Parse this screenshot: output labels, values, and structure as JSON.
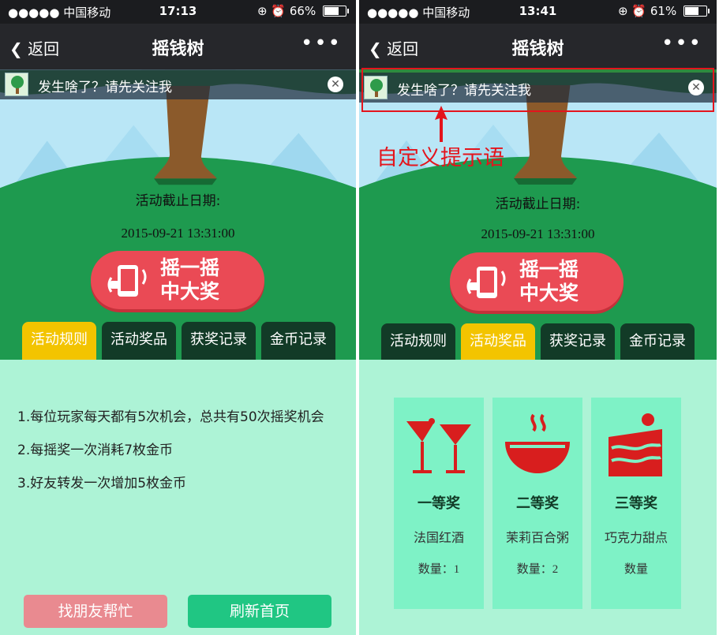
{
  "screens": [
    {
      "status": {
        "carrier": "●●●●● 中国移动",
        "time": "17:13",
        "battery": "66%",
        "battery_level": 0.66
      },
      "nav": {
        "back": "返回",
        "title": "摇钱树",
        "more": "•••"
      },
      "notice": {
        "text": "发生啥了？请先关注我",
        "close": "✕"
      },
      "deadline_label": "活动截止日期:",
      "deadline_value": "2015-09-21 13:31:00",
      "shake_button": {
        "line1": "摇一摇",
        "line2": "中大奖"
      },
      "tabs": [
        "活动规则",
        "活动奖品",
        "获奖记录",
        "金币记录"
      ],
      "active_tab": "活动规则",
      "rules": [
        "1.每位玩家每天都有5次机会，总共有50次摇奖机会",
        "2.每摇奖一次消耗7枚金币",
        "3.好友转发一次增加5枚金币"
      ],
      "buttons": {
        "help": "找朋友帮忙",
        "refresh": "刷新首页"
      }
    },
    {
      "status": {
        "carrier": "●●●●● 中国移动",
        "time": "13:41",
        "battery": "61%",
        "battery_level": 0.61
      },
      "nav": {
        "back": "返回",
        "title": "摇钱树",
        "more": "•••"
      },
      "notice": {
        "text": "发生啥了？请先关注我",
        "close": "✕"
      },
      "annotation": "自定义提示语",
      "deadline_label": "活动截止日期:",
      "deadline_value": "2015-09-21 13:31:00",
      "shake_button": {
        "line1": "摇一摇",
        "line2": "中大奖"
      },
      "tabs": [
        "活动规则",
        "活动奖品",
        "获奖记录",
        "金币记录"
      ],
      "active_tab": "活动奖品",
      "prizes": [
        {
          "rank": "一等奖",
          "name": "法国红酒",
          "qty": "数量：1",
          "icon": "cocktail-icon"
        },
        {
          "rank": "二等奖",
          "name": "茉莉百合粥",
          "qty": "数量：2",
          "icon": "soup-bowl-icon"
        },
        {
          "rank": "三等奖",
          "name": "巧克力甜点",
          "qty": "数量",
          "icon": "cake-icon"
        }
      ]
    }
  ],
  "colors": {
    "status_bg": "#1b1c1f",
    "nav_bg": "#26272b",
    "sky": "#b9e6f6",
    "hill": "#1e9a4f",
    "tab_bg": "#123b27",
    "tab_active": "#f3c400",
    "content_bg": "#adf3d6",
    "shake_red": "#ea4a55",
    "help_btn": "#e98a90",
    "refresh_btn": "#20c683",
    "annotation_red": "#e4141c",
    "prize_card": "#7ef2c6",
    "prize_icon": "#d81e1e"
  }
}
